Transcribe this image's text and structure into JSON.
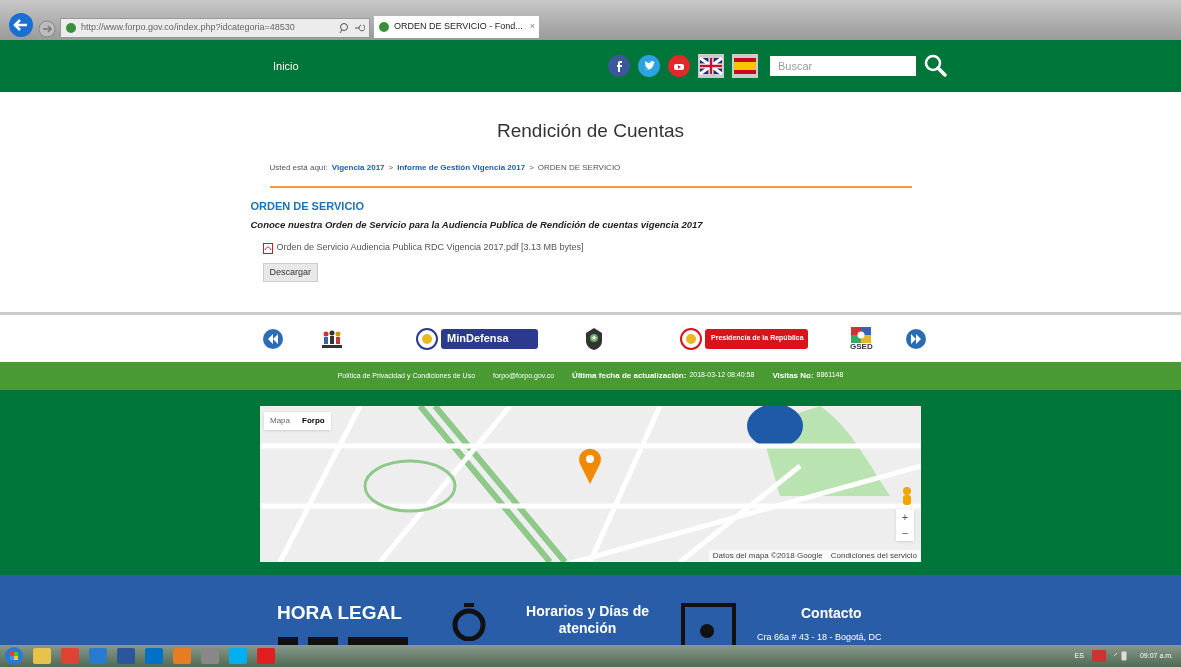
{
  "browser": {
    "url": "http://www.forpo.gov.co/index.php?idcategoria=48530",
    "tab_title": "ORDEN DE SERVICIO - Fond...",
    "tab_close": "×"
  },
  "nav": {
    "link": "Inicio",
    "search_placeholder": "Buscar"
  },
  "page_title": "Rendición de Cuentas",
  "breadcrumb": {
    "label": "Usted está aquí:",
    "separators": [
      ">",
      ">"
    ],
    "items": [
      {
        "text": "Vigencia 2017",
        "kind": "link"
      },
      {
        "text": "Informe de Gestión Vigencia 2017",
        "kind": "link"
      },
      {
        "text": "ORDEN DE SERVICIO",
        "kind": "current"
      }
    ]
  },
  "article": {
    "heading": "ORDEN DE SERVICIO",
    "intro": "Conoce nuestra Orden de Servicio para la Audiencia Publica de Rendición de cuentas vigencia 2017",
    "file": "Orden de Servicio Audiencia Publica RDC Vigencia 2017.pdf [3.13 MB bytes]",
    "button": "Descargar"
  },
  "logos": [
    {
      "kind": "people"
    },
    {
      "kind": "badge",
      "text": "MinDefensa",
      "color": "#2b3a8c"
    },
    {
      "kind": "emblem"
    },
    {
      "kind": "badge",
      "text": "Presidencia de la República",
      "color": "#d7141a"
    },
    {
      "kind": "gsed",
      "text": "GSED"
    }
  ],
  "footer_bar": {
    "privacy": "Política de Privacidad y Condiciones de Uso",
    "email": "forpo@forpo.gov.co",
    "updated_label": "Última fecha de actualización:",
    "updated_value": "2018-03-12 08:40:58",
    "visits_label": "Visitas No:",
    "visits_value": "8861148"
  },
  "map": {
    "tabs": [
      {
        "label": "Mapa",
        "selected": false
      },
      {
        "label": "Forpo",
        "selected": true
      }
    ],
    "zoom_in": "+",
    "zoom_out": "−",
    "attribution": "Datos del mapa ©2018 Google",
    "terms": "Condiciones del servicio"
  },
  "info": {
    "clock_title": "HORA LEGAL",
    "hours_title": "Horarios y Días de atención",
    "contact_title": "Contacto",
    "address": "Cra 66a # 43 - 18 - Bogotá, DC"
  },
  "taskbar": {
    "language": "ES",
    "time": "09:07 a.m."
  }
}
